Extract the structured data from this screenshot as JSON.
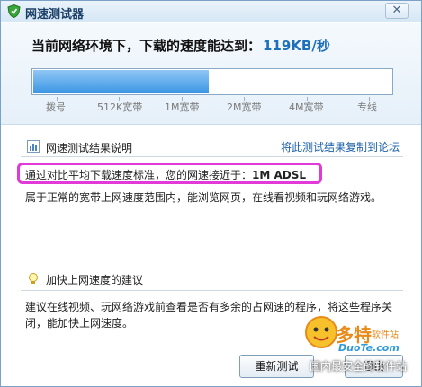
{
  "window": {
    "title": "网速测试器",
    "close_glyph": "✕"
  },
  "speed": {
    "prefix": "当前网络环境下，下载的速度能达到：",
    "value": "119KB/秒",
    "meter_fill_fraction": 0.49
  },
  "scale": [
    "拨号",
    "512K宽带",
    "1M宽带",
    "2M宽带",
    "4M宽带",
    "专线"
  ],
  "results": {
    "title": "网速测试结果说明",
    "copy_link": "将此测试结果复制到论坛",
    "conclusion_prefix": "通过对比平均下载速度标准，您的网速接近于：",
    "conclusion_value": "1M ADSL",
    "description": "属于正常的宽带上网速度范围内，能浏览网页，在线看视频和玩网络游戏。"
  },
  "advice": {
    "title": "加快上网速度的建议",
    "line1": "建议在线视频、玩网络游戏前查看是否有多余的占网速的程序，将这些程序关",
    "line2": "闭，能加快上网速度。"
  },
  "buttons": {
    "retest": "重新测试",
    "exit": "退出"
  },
  "watermark": {
    "name": "多特",
    "sub": "软件站",
    "url": "DuoTe.com",
    "corner": "国内最安全的软件站"
  },
  "colors": {
    "accent": "#1f6fba",
    "highlight": "#e23ad8",
    "meter_fill": "#3b95e4"
  }
}
